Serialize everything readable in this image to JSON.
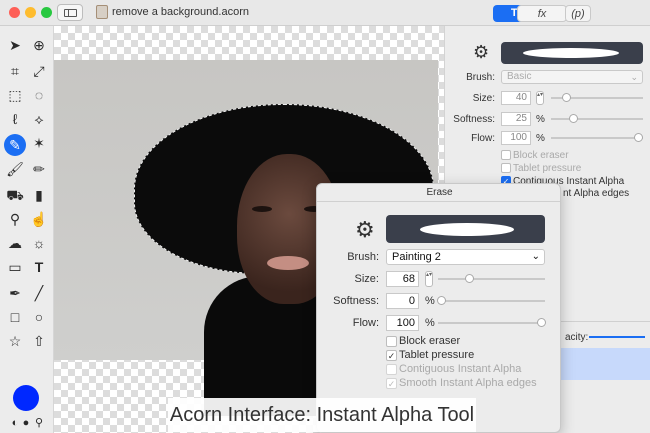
{
  "window": {
    "title": "remove a background.acorn",
    "colors": {
      "close": "#fe5f57",
      "minimize": "#febc2e",
      "zoom": "#28c840",
      "accent": "#1b6ef3"
    }
  },
  "toolbar_segments": {
    "tools_label": "T↕",
    "fx_label": "fx",
    "p_label": "(p)"
  },
  "tool_icons": [
    "arrow-icon",
    "zoom-icon",
    "crop-icon",
    "transform-icon",
    "marquee-icon",
    "ellipse-marquee-icon",
    "lasso-icon",
    "poly-lasso-icon",
    "magic-wand-icon",
    "instant-alpha-icon",
    "brush-icon",
    "pencil-icon",
    "paint-bucket-icon",
    "clone-icon",
    "eraser-icon",
    "smudge-icon",
    "cloud-icon",
    "sun-icon",
    "gradient-icon",
    "text-icon",
    "pen-icon",
    "line-icon",
    "rect-icon",
    "circle-icon",
    "star-icon",
    "arrow-shape-icon"
  ],
  "inspector": {
    "brush_label": "Brush:",
    "brush_value": "Basic",
    "size_label": "Size:",
    "size_value": "40",
    "softness_label": "Softness:",
    "softness_value": "25",
    "softness_unit": "%",
    "flow_label": "Flow:",
    "flow_value": "100",
    "flow_unit": "%",
    "block_eraser": "Block eraser",
    "tablet_pressure": "Tablet pressure",
    "contiguous": "Contiguous Instant Alpha",
    "smooth_partial": "nt Alpha edges",
    "opacity_partial": "acity:"
  },
  "erase_panel": {
    "title": "Erase",
    "brush_label": "Brush:",
    "brush_value": "Painting 2",
    "size_label": "Size:",
    "size_value": "68",
    "softness_label": "Softness:",
    "softness_value": "0",
    "softness_unit": "%",
    "flow_label": "Flow:",
    "flow_value": "100",
    "flow_unit": "%",
    "block_eraser": "Block eraser",
    "tablet_pressure": "Tablet pressure",
    "contiguous": "Contiguous Instant Alpha",
    "smooth": "Smooth Instant Alpha edges"
  },
  "caption": "Acorn Interface: Instant Alpha Tool"
}
